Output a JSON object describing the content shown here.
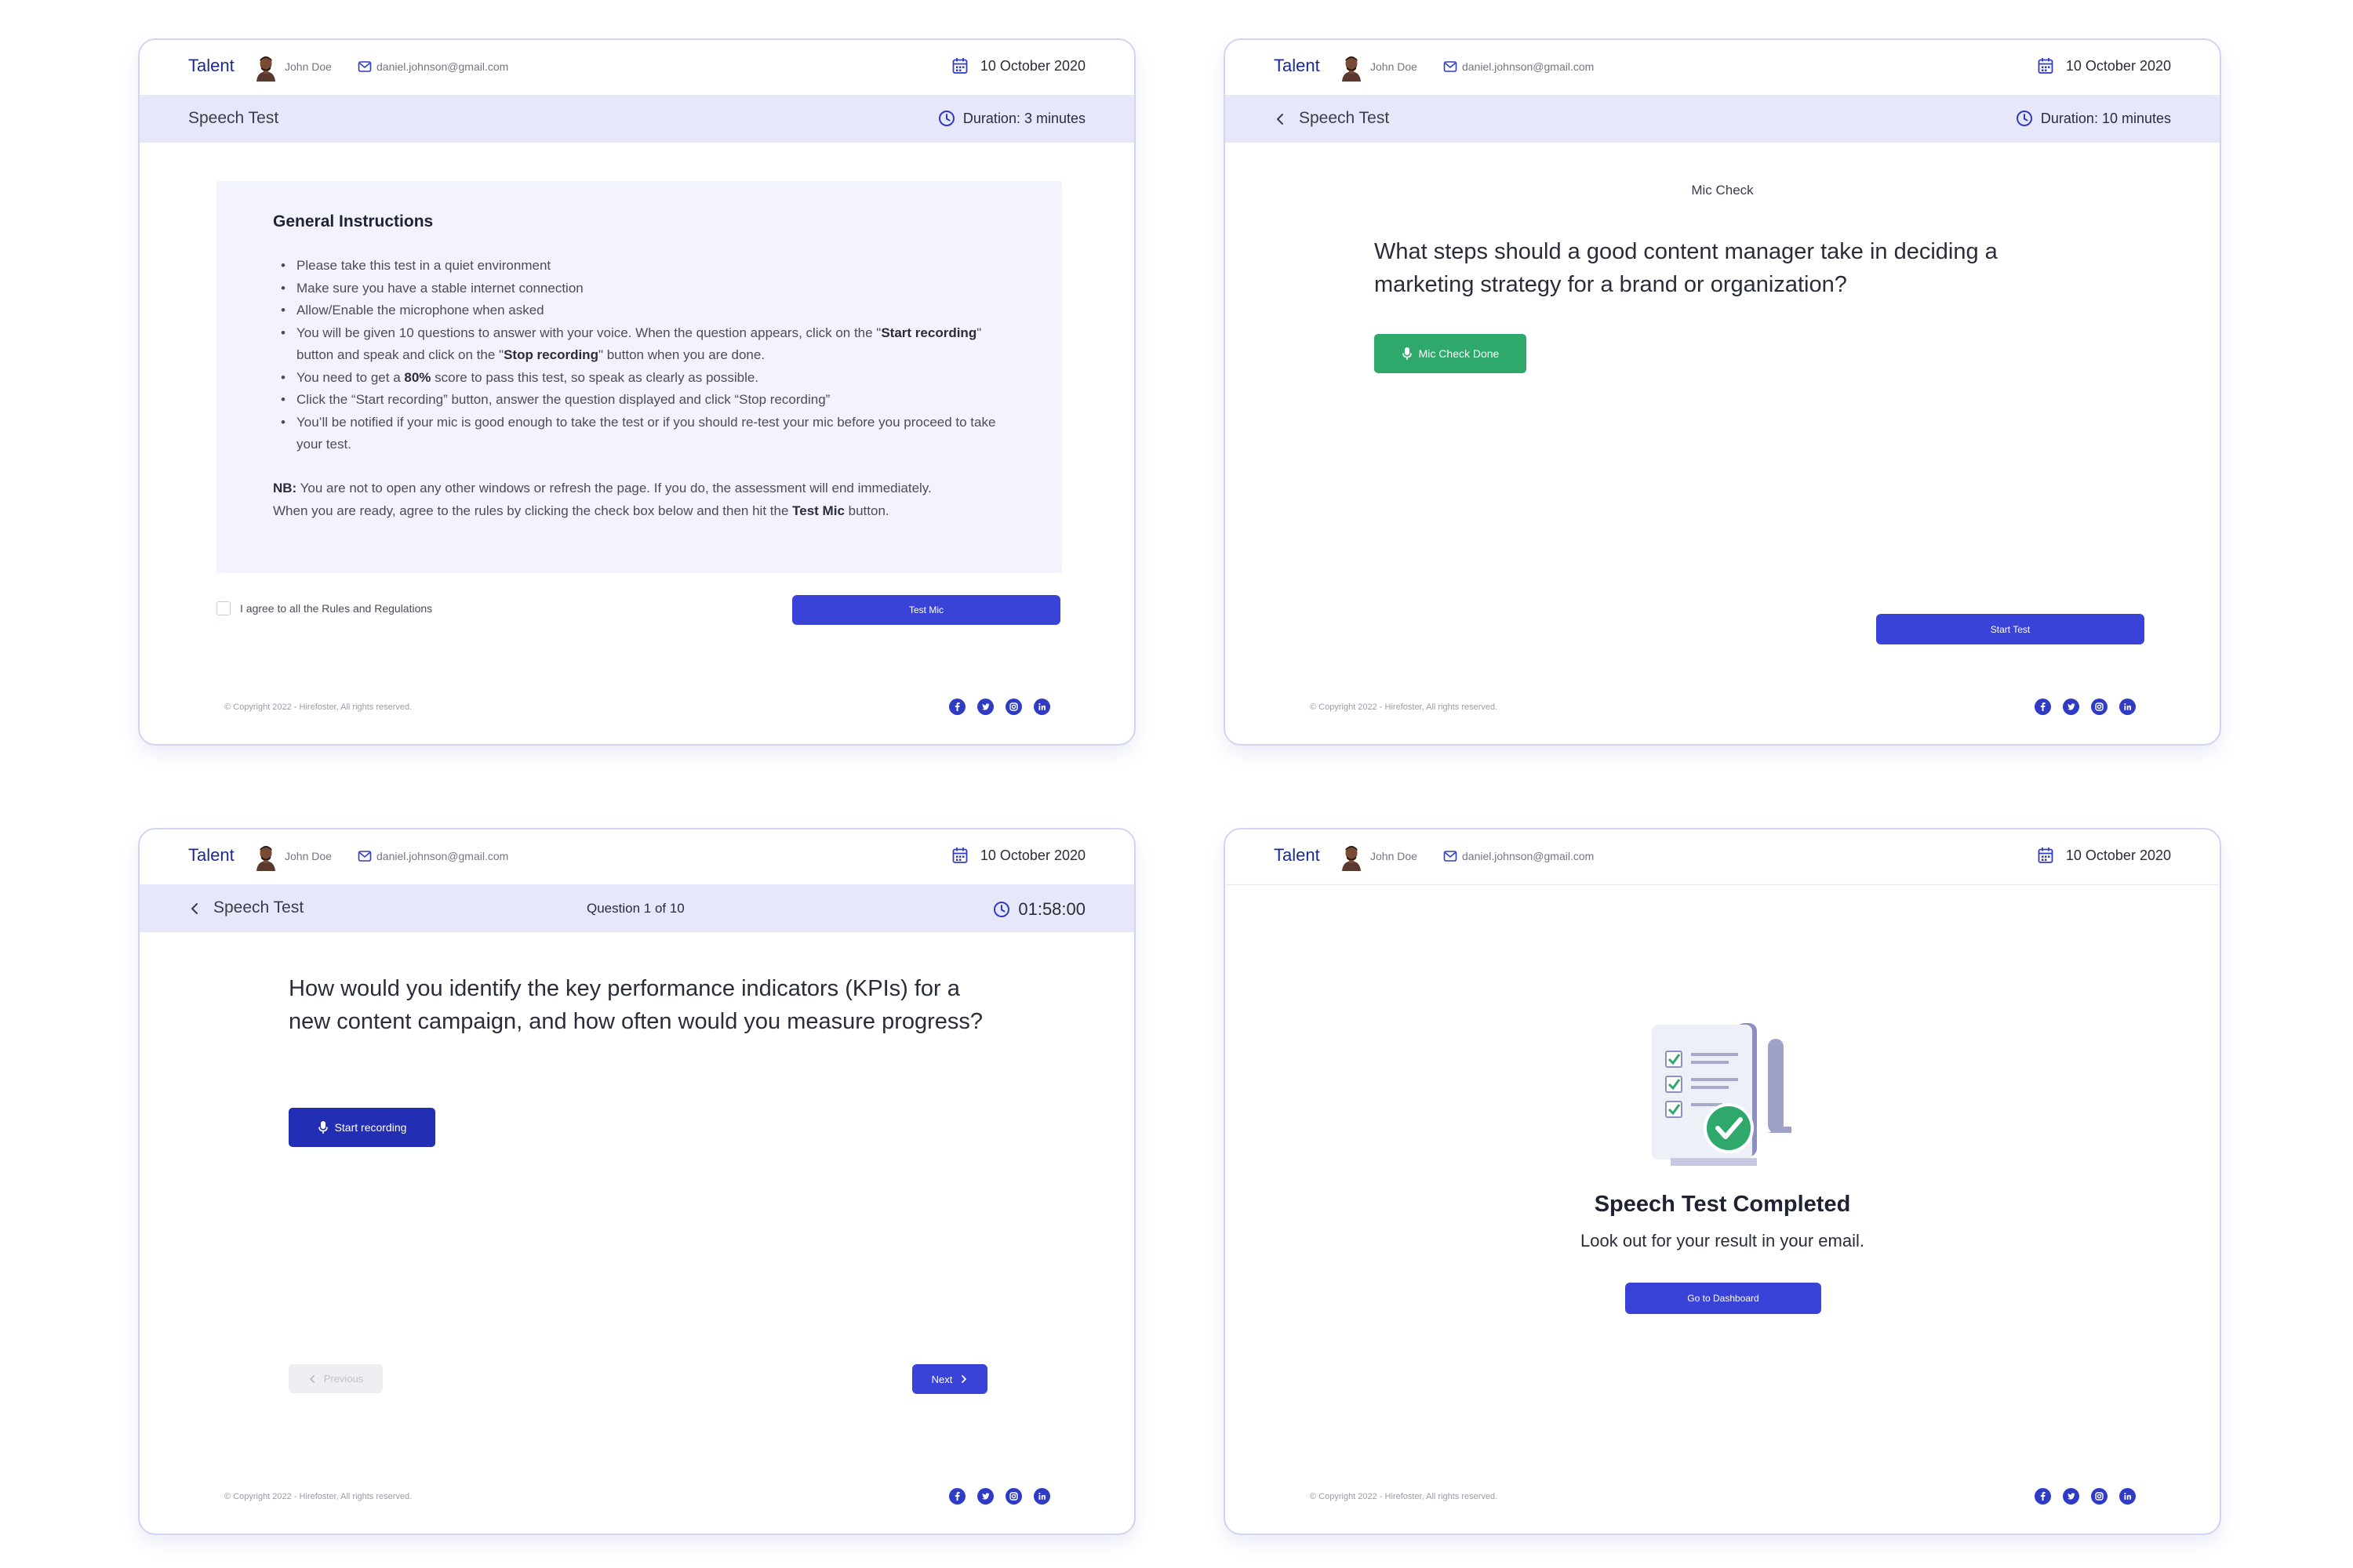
{
  "brand": "Talent",
  "user": {
    "name": "John Doe",
    "email": "daniel.johnson@gmail.com"
  },
  "date": "10 October 2020",
  "footer": {
    "copyright": "© Copyright 2022 - Hirefoster, All rights reserved."
  },
  "socials": [
    "facebook-icon",
    "twitter-icon",
    "instagram-icon",
    "linkedin-icon"
  ],
  "colors": {
    "primary": "#3a43d8",
    "primary_dark": "#222fb5",
    "success": "#2ea96b",
    "subbar": "#e6e8f9",
    "panel": "#f2f3fd",
    "border": "#d2d4f4"
  },
  "screen1": {
    "title": "Speech Test",
    "duration": "Duration: 3 minutes",
    "instructions_heading": "General Instructions",
    "instructions": {
      "i1": "Please take this test in a quiet environment",
      "i2": "Make sure you have a stable internet connection",
      "i3": "Allow/Enable the microphone when asked",
      "i4a": "You will be given 10 questions to answer with your voice. When the question appears, click on the \"",
      "i4b": "Start recording",
      "i4c": "\" button and speak and click on the \"",
      "i4d": "Stop recording",
      "i4e": "\" button when you are done.",
      "i5a": "You need to get a ",
      "i5b": "80%",
      "i5c": " score to pass this test, so speak as clearly as possible.",
      "i6": "Click the “Start recording” button, answer the question displayed and click “Stop recording”",
      "i7": "You’ll be notified if your mic is good enough to take the test or if you should re-test your mic before you proceed to take your test."
    },
    "nb_label": "NB:",
    "nb_text": " You are not to open any other windows or refresh the page. If you do, the assessment will end immediately.",
    "ready_text": "When you are ready, agree to the rules by clicking the check box below and then hit the ",
    "ready_bold": "Test Mic",
    "ready_end": " button.",
    "agree_label": "I agree to all the Rules and Regulations",
    "agree_checked": false,
    "test_mic_button": "Test Mic"
  },
  "screen2": {
    "title": "Speech Test",
    "duration": "Duration: 10 minutes",
    "mic_check_label": "Mic Check",
    "question": "What steps should a good content manager take in deciding a marketing strategy for a brand or organization?",
    "mic_check_done_button": "Mic Check Done",
    "start_test_button": "Start Test"
  },
  "screen3": {
    "title": "Speech Test",
    "question_counter": "Question 1 of 10",
    "timer": "01:58:00",
    "question": "How would you identify the key performance indicators (KPIs) for a new content campaign, and how often would you measure progress?",
    "start_recording_button": "Start recording",
    "previous_button": "Previous",
    "next_button": "Next"
  },
  "screen4": {
    "title": "Speech Test Completed",
    "subtitle": "Look out for your result in your email.",
    "dashboard_button": "Go to Dashboard"
  }
}
